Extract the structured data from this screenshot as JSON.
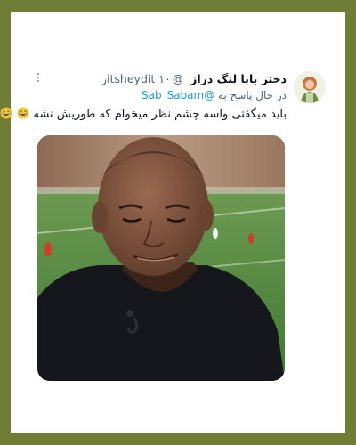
{
  "tweet": {
    "display_name": "دختر بابا لنگ دراز",
    "handle": "@itsheydit",
    "time": "۱۰ر",
    "reply_prefix": "در حال پاسخ به",
    "reply_to": "@Sab_Sabam",
    "text": "باید میگفتی واسه چشم نظر میخوام که طوریش نشه",
    "emojis": [
      "face-with-tears-of-joy",
      "face-with-tears-of-joy"
    ]
  },
  "colors": {
    "frame": "#6f7d35",
    "card": "#ffffff",
    "name": "#0f1419",
    "secondary": "#536471",
    "link": "#1d9bf0"
  },
  "icons": {
    "more": "more-dots-icon",
    "avatar": "avatar"
  },
  "media": {
    "kind": "photo",
    "subject": "man-in-dark-shirt-tv-studio"
  }
}
